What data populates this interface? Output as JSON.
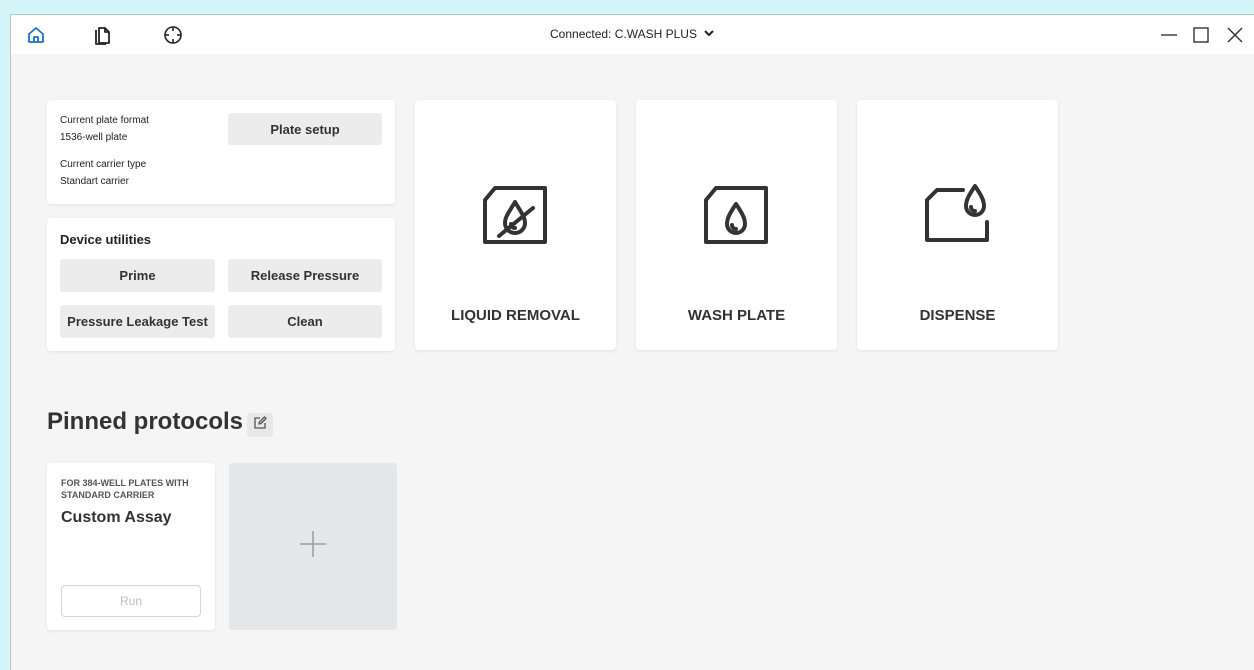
{
  "titlebar": {
    "connection_label": "Connected: C.WASH PLUS",
    "icons": [
      "home-icon",
      "documents-icon",
      "crosshair-icon"
    ],
    "window_controls": [
      "minimize-icon",
      "maximize-icon",
      "close-icon"
    ]
  },
  "plate": {
    "format_label": "Current plate format",
    "format_value": "1536-well plate",
    "carrier_label": "Current carrier type",
    "carrier_value": "Standart carrier",
    "setup_button": "Plate setup"
  },
  "utilities": {
    "title": "Device utilities",
    "prime": "Prime",
    "release_pressure": "Release Pressure",
    "pressure_leakage_test": "Pressure Leakage Test",
    "clean": "Clean"
  },
  "actions": {
    "liquid_removal": "LIQUID REMOVAL",
    "wash_plate": "WASH PLATE",
    "dispense": "DISPENSE"
  },
  "pinned": {
    "title": "Pinned protocols",
    "protocols": [
      {
        "subtitle": "FOR 384-WELL PLATES WITH STANDARD CARRIER",
        "name": "Custom Assay",
        "run_label": "Run"
      }
    ],
    "add_label": "+"
  },
  "colors": {
    "accent": "#1a73c8",
    "background": "#f5f5f5",
    "outer": "#d5f6f8"
  }
}
